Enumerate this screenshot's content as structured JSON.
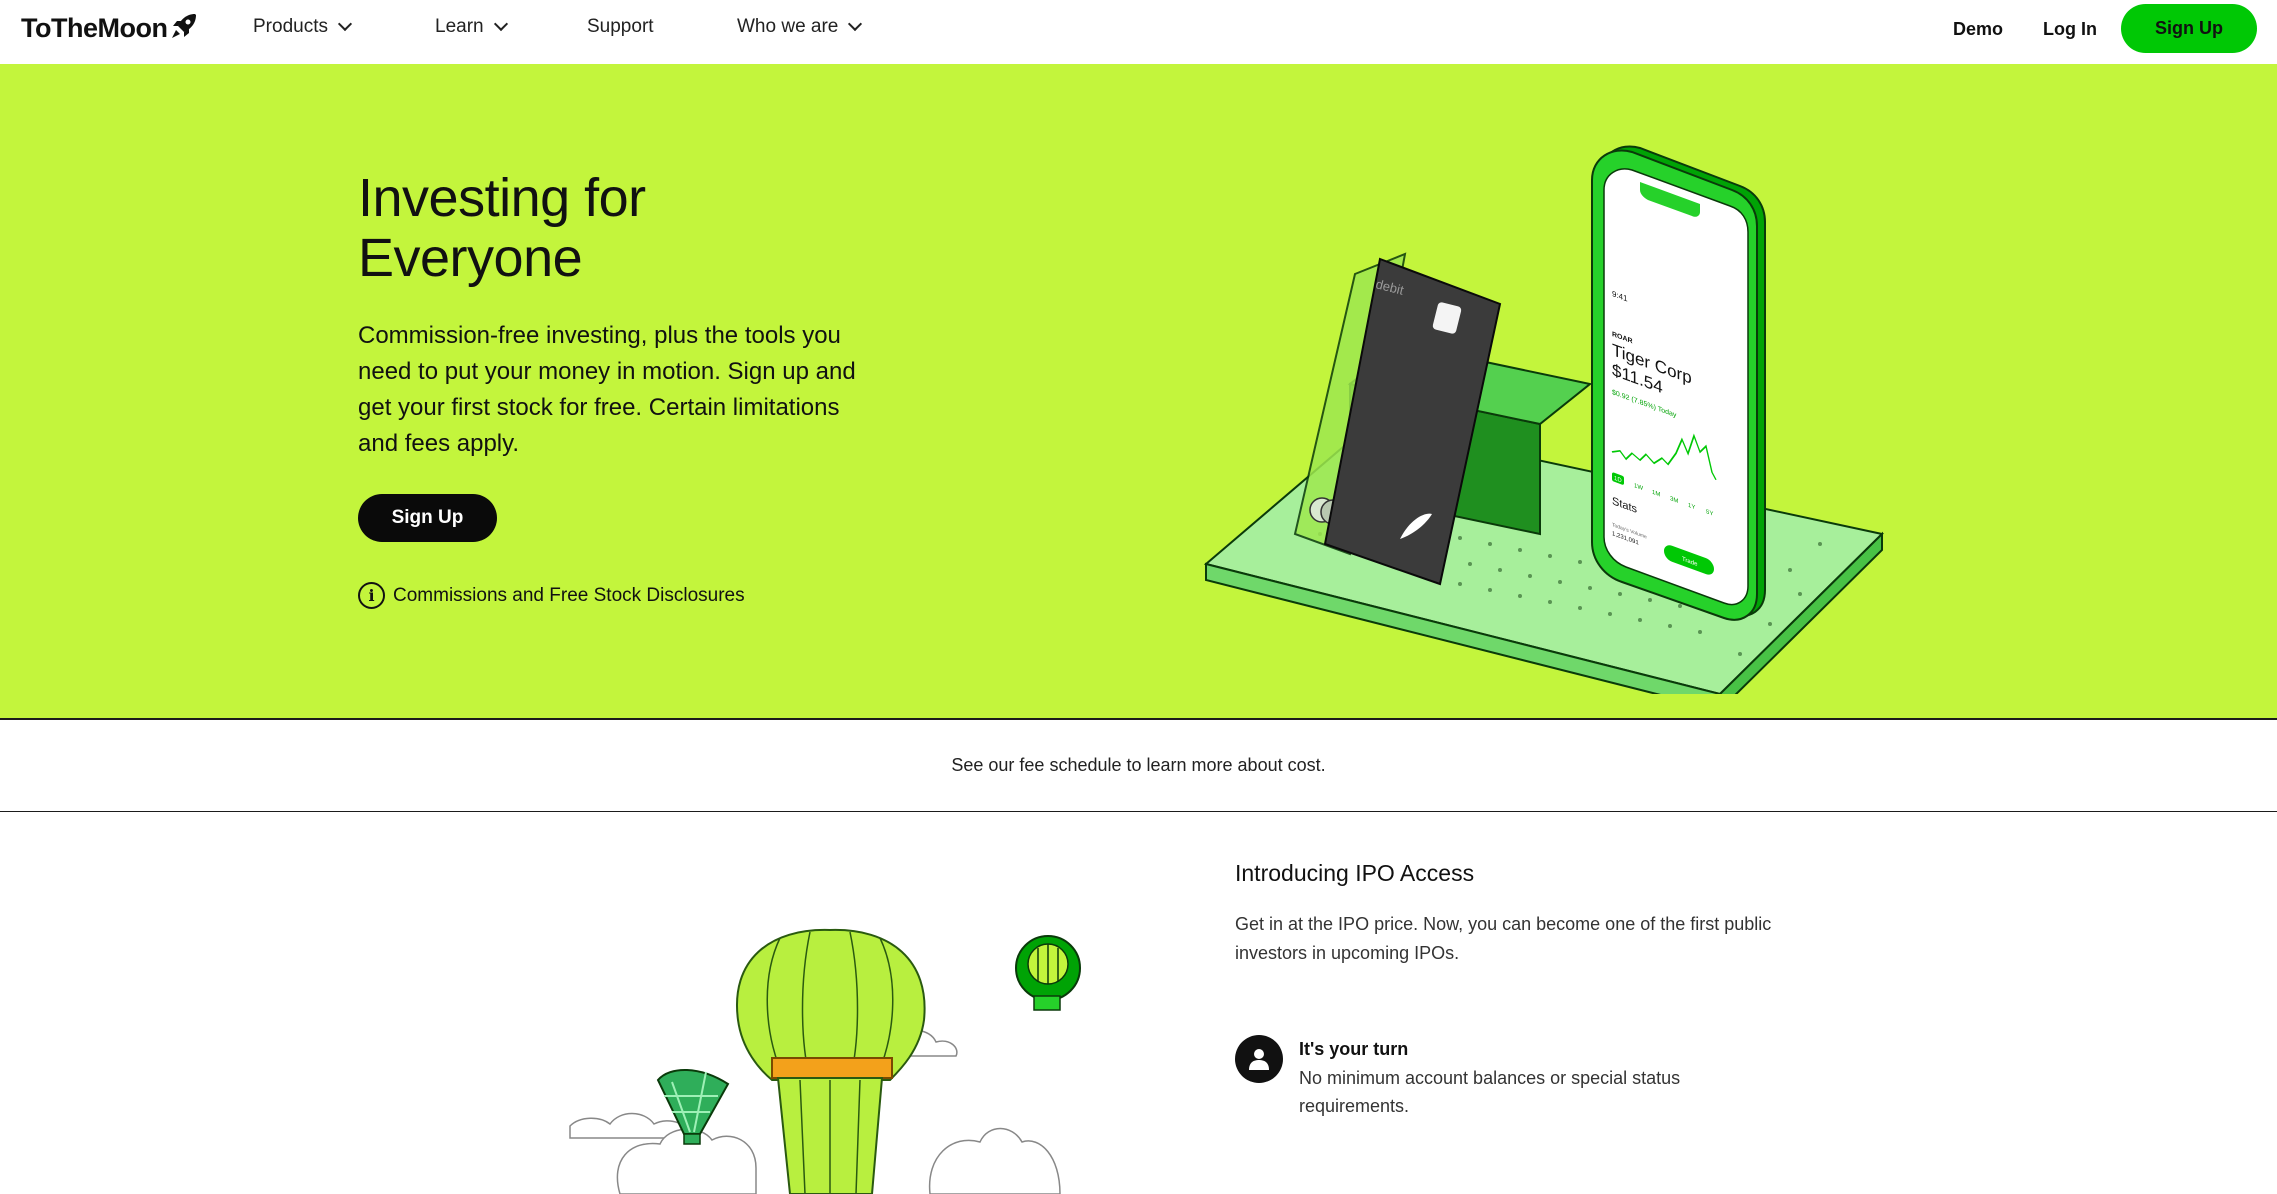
{
  "nav": {
    "logo": "ToTheMoon",
    "items": [
      {
        "label": "Products",
        "has_dropdown": true
      },
      {
        "label": "Learn",
        "has_dropdown": true
      },
      {
        "label": "Support",
        "has_dropdown": false
      },
      {
        "label": "Who we are",
        "has_dropdown": true
      }
    ],
    "demo": "Demo",
    "login": "Log In",
    "signup": "Sign Up"
  },
  "hero": {
    "title": "Investing for Everyone",
    "description": "Commission-free investing, plus the tools you need to put your money in motion. Sign up and get your first stock for free. Certain limitations and fees apply.",
    "signup": "Sign Up",
    "disclosure": "Commissions and Free Stock Disclosures",
    "phone": {
      "time": "9:41",
      "ticker": "ROAR",
      "company": "Tiger Corp",
      "price": "$11.54",
      "change": "$0.92 (7.85%) Today",
      "ranges": [
        "1D",
        "1W",
        "1M",
        "3M",
        "1Y",
        "5Y"
      ],
      "stats_label": "Stats",
      "volume_label": "Today's Volume",
      "volume": "1,231,091",
      "trade": "Trade"
    },
    "card_label": "debit"
  },
  "fee": {
    "text": "See our fee schedule to learn more about cost."
  },
  "ipo": {
    "title": "Introducing IPO Access",
    "description": "Get in at the IPO price. Now, you can become one of the first public investors in upcoming IPOs.",
    "feature_title": "It's your turn",
    "feature_desc": "No minimum account balances or special status requirements."
  },
  "colors": {
    "hero_bg": "#c3f53c",
    "brand_green": "#00c805",
    "black": "#0a0a0a"
  }
}
